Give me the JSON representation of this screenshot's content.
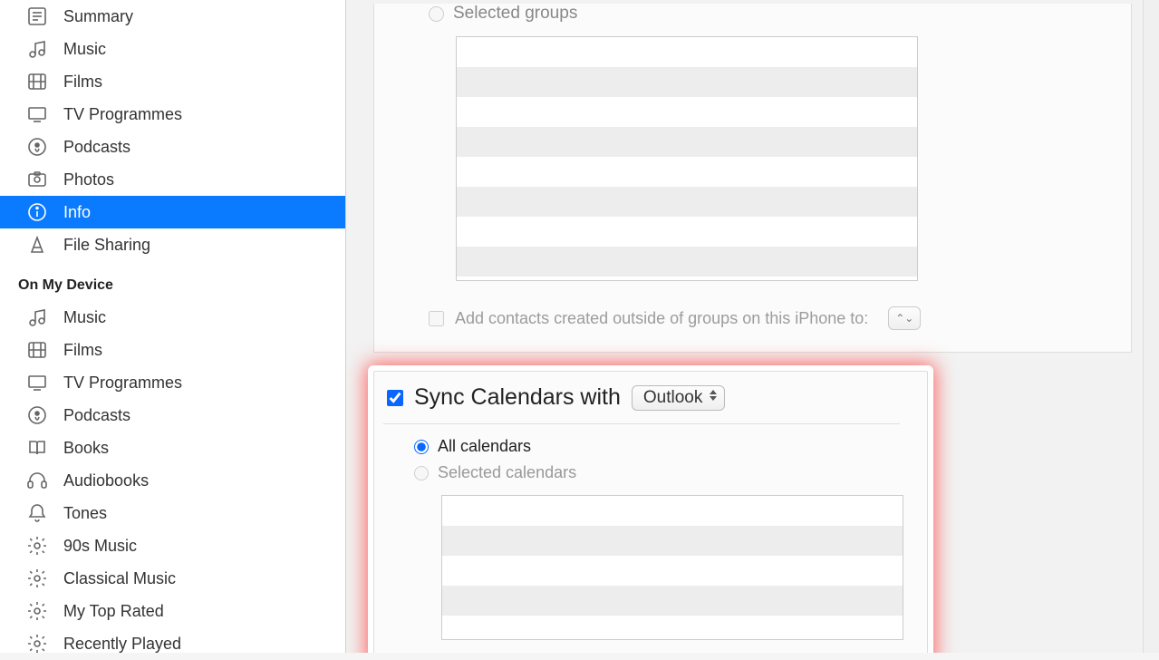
{
  "sidebar": {
    "settings": [
      {
        "icon": "summary",
        "label": "Summary"
      },
      {
        "icon": "music",
        "label": "Music"
      },
      {
        "icon": "films",
        "label": "Films"
      },
      {
        "icon": "tv",
        "label": "TV Programmes"
      },
      {
        "icon": "podcasts",
        "label": "Podcasts"
      },
      {
        "icon": "photos",
        "label": "Photos"
      },
      {
        "icon": "info",
        "label": "Info"
      },
      {
        "icon": "filesharing",
        "label": "File Sharing"
      }
    ],
    "device_header": "On My Device",
    "device": [
      {
        "icon": "music",
        "label": "Music"
      },
      {
        "icon": "films",
        "label": "Films"
      },
      {
        "icon": "tv",
        "label": "TV Programmes"
      },
      {
        "icon": "podcasts",
        "label": "Podcasts"
      },
      {
        "icon": "books",
        "label": "Books"
      },
      {
        "icon": "audiobooks",
        "label": "Audiobooks"
      },
      {
        "icon": "tones",
        "label": "Tones"
      },
      {
        "icon": "playlist",
        "label": "90s Music"
      },
      {
        "icon": "playlist",
        "label": "Classical Music"
      },
      {
        "icon": "playlist",
        "label": "My Top Rated"
      },
      {
        "icon": "playlist",
        "label": "Recently Played"
      }
    ]
  },
  "contacts_panel": {
    "selected_groups_label": "Selected groups",
    "add_contacts_label": "Add contacts created outside of groups on this iPhone to:"
  },
  "calendars_panel": {
    "sync_label": "Sync Calendars with",
    "sync_app": "Outlook",
    "all_label": "All calendars",
    "selected_label": "Selected calendars"
  }
}
